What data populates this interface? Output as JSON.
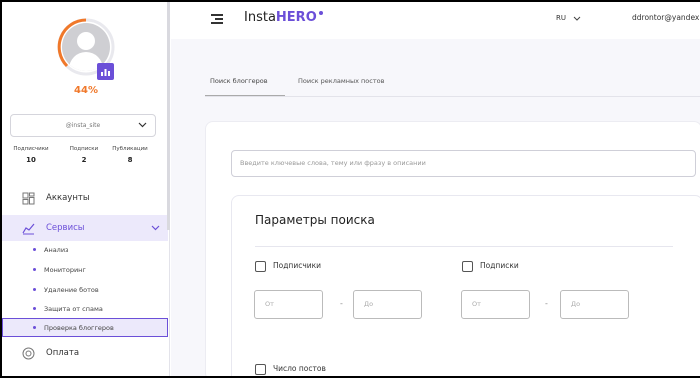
{
  "sidebar": {
    "percent": "44%",
    "account": "@insta_site",
    "stats": [
      {
        "label": "Подписчики",
        "value": "10"
      },
      {
        "label": "Подписки",
        "value": "2"
      },
      {
        "label": "Публикации",
        "value": "8"
      }
    ],
    "nav": {
      "accounts": "Аккаунты",
      "services": "Сервисы",
      "payment": "Оплата"
    },
    "sub_items": [
      "Анализ",
      "Мониторинг",
      "Удаление ботов",
      "Защита от спама",
      "Проверка блоггеров"
    ],
    "accent_color": "#6b4fd8",
    "percent_color": "#f0782a"
  },
  "header": {
    "logo_text": "Insta",
    "logo_accent": "HERO",
    "language": "RU",
    "email": "ddrontor@yandex.r"
  },
  "main": {
    "tabs": [
      "Поиск блоггеров",
      "Поиск рекламных постов"
    ],
    "search_placeholder": "Введите ключевые слова, тему или фразу в описании",
    "params": {
      "title": "Параметры поиска",
      "followers_label": "Подписчики",
      "following_label": "Подписки",
      "posts_label": "Число постов",
      "from_placeholder": "От",
      "to_placeholder": "До",
      "dash": "-"
    }
  }
}
